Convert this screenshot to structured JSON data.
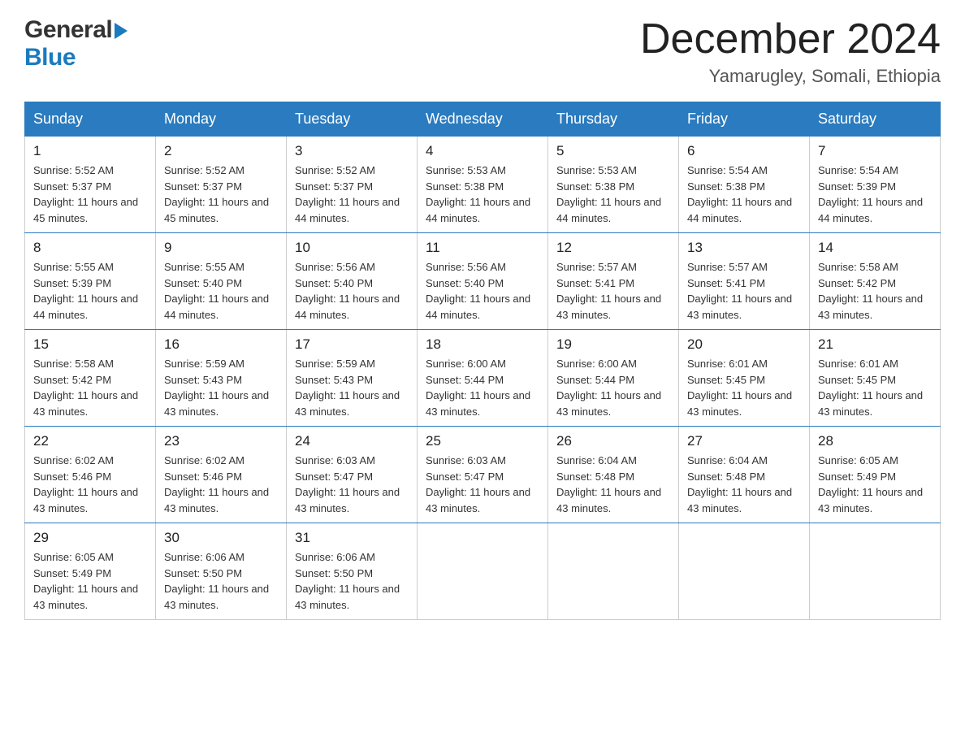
{
  "header": {
    "logo_general": "General",
    "logo_blue": "Blue",
    "title": "December 2024",
    "subtitle": "Yamarugley, Somali, Ethiopia"
  },
  "columns": [
    "Sunday",
    "Monday",
    "Tuesday",
    "Wednesday",
    "Thursday",
    "Friday",
    "Saturday"
  ],
  "weeks": [
    [
      {
        "day": "1",
        "sunrise": "Sunrise: 5:52 AM",
        "sunset": "Sunset: 5:37 PM",
        "daylight": "Daylight: 11 hours and 45 minutes."
      },
      {
        "day": "2",
        "sunrise": "Sunrise: 5:52 AM",
        "sunset": "Sunset: 5:37 PM",
        "daylight": "Daylight: 11 hours and 45 minutes."
      },
      {
        "day": "3",
        "sunrise": "Sunrise: 5:52 AM",
        "sunset": "Sunset: 5:37 PM",
        "daylight": "Daylight: 11 hours and 44 minutes."
      },
      {
        "day": "4",
        "sunrise": "Sunrise: 5:53 AM",
        "sunset": "Sunset: 5:38 PM",
        "daylight": "Daylight: 11 hours and 44 minutes."
      },
      {
        "day": "5",
        "sunrise": "Sunrise: 5:53 AM",
        "sunset": "Sunset: 5:38 PM",
        "daylight": "Daylight: 11 hours and 44 minutes."
      },
      {
        "day": "6",
        "sunrise": "Sunrise: 5:54 AM",
        "sunset": "Sunset: 5:38 PM",
        "daylight": "Daylight: 11 hours and 44 minutes."
      },
      {
        "day": "7",
        "sunrise": "Sunrise: 5:54 AM",
        "sunset": "Sunset: 5:39 PM",
        "daylight": "Daylight: 11 hours and 44 minutes."
      }
    ],
    [
      {
        "day": "8",
        "sunrise": "Sunrise: 5:55 AM",
        "sunset": "Sunset: 5:39 PM",
        "daylight": "Daylight: 11 hours and 44 minutes."
      },
      {
        "day": "9",
        "sunrise": "Sunrise: 5:55 AM",
        "sunset": "Sunset: 5:40 PM",
        "daylight": "Daylight: 11 hours and 44 minutes."
      },
      {
        "day": "10",
        "sunrise": "Sunrise: 5:56 AM",
        "sunset": "Sunset: 5:40 PM",
        "daylight": "Daylight: 11 hours and 44 minutes."
      },
      {
        "day": "11",
        "sunrise": "Sunrise: 5:56 AM",
        "sunset": "Sunset: 5:40 PM",
        "daylight": "Daylight: 11 hours and 44 minutes."
      },
      {
        "day": "12",
        "sunrise": "Sunrise: 5:57 AM",
        "sunset": "Sunset: 5:41 PM",
        "daylight": "Daylight: 11 hours and 43 minutes."
      },
      {
        "day": "13",
        "sunrise": "Sunrise: 5:57 AM",
        "sunset": "Sunset: 5:41 PM",
        "daylight": "Daylight: 11 hours and 43 minutes."
      },
      {
        "day": "14",
        "sunrise": "Sunrise: 5:58 AM",
        "sunset": "Sunset: 5:42 PM",
        "daylight": "Daylight: 11 hours and 43 minutes."
      }
    ],
    [
      {
        "day": "15",
        "sunrise": "Sunrise: 5:58 AM",
        "sunset": "Sunset: 5:42 PM",
        "daylight": "Daylight: 11 hours and 43 minutes."
      },
      {
        "day": "16",
        "sunrise": "Sunrise: 5:59 AM",
        "sunset": "Sunset: 5:43 PM",
        "daylight": "Daylight: 11 hours and 43 minutes."
      },
      {
        "day": "17",
        "sunrise": "Sunrise: 5:59 AM",
        "sunset": "Sunset: 5:43 PM",
        "daylight": "Daylight: 11 hours and 43 minutes."
      },
      {
        "day": "18",
        "sunrise": "Sunrise: 6:00 AM",
        "sunset": "Sunset: 5:44 PM",
        "daylight": "Daylight: 11 hours and 43 minutes."
      },
      {
        "day": "19",
        "sunrise": "Sunrise: 6:00 AM",
        "sunset": "Sunset: 5:44 PM",
        "daylight": "Daylight: 11 hours and 43 minutes."
      },
      {
        "day": "20",
        "sunrise": "Sunrise: 6:01 AM",
        "sunset": "Sunset: 5:45 PM",
        "daylight": "Daylight: 11 hours and 43 minutes."
      },
      {
        "day": "21",
        "sunrise": "Sunrise: 6:01 AM",
        "sunset": "Sunset: 5:45 PM",
        "daylight": "Daylight: 11 hours and 43 minutes."
      }
    ],
    [
      {
        "day": "22",
        "sunrise": "Sunrise: 6:02 AM",
        "sunset": "Sunset: 5:46 PM",
        "daylight": "Daylight: 11 hours and 43 minutes."
      },
      {
        "day": "23",
        "sunrise": "Sunrise: 6:02 AM",
        "sunset": "Sunset: 5:46 PM",
        "daylight": "Daylight: 11 hours and 43 minutes."
      },
      {
        "day": "24",
        "sunrise": "Sunrise: 6:03 AM",
        "sunset": "Sunset: 5:47 PM",
        "daylight": "Daylight: 11 hours and 43 minutes."
      },
      {
        "day": "25",
        "sunrise": "Sunrise: 6:03 AM",
        "sunset": "Sunset: 5:47 PM",
        "daylight": "Daylight: 11 hours and 43 minutes."
      },
      {
        "day": "26",
        "sunrise": "Sunrise: 6:04 AM",
        "sunset": "Sunset: 5:48 PM",
        "daylight": "Daylight: 11 hours and 43 minutes."
      },
      {
        "day": "27",
        "sunrise": "Sunrise: 6:04 AM",
        "sunset": "Sunset: 5:48 PM",
        "daylight": "Daylight: 11 hours and 43 minutes."
      },
      {
        "day": "28",
        "sunrise": "Sunrise: 6:05 AM",
        "sunset": "Sunset: 5:49 PM",
        "daylight": "Daylight: 11 hours and 43 minutes."
      }
    ],
    [
      {
        "day": "29",
        "sunrise": "Sunrise: 6:05 AM",
        "sunset": "Sunset: 5:49 PM",
        "daylight": "Daylight: 11 hours and 43 minutes."
      },
      {
        "day": "30",
        "sunrise": "Sunrise: 6:06 AM",
        "sunset": "Sunset: 5:50 PM",
        "daylight": "Daylight: 11 hours and 43 minutes."
      },
      {
        "day": "31",
        "sunrise": "Sunrise: 6:06 AM",
        "sunset": "Sunset: 5:50 PM",
        "daylight": "Daylight: 11 hours and 43 minutes."
      },
      null,
      null,
      null,
      null
    ]
  ],
  "colors": {
    "header_bg": "#2a7bbf",
    "header_text": "#ffffff",
    "border": "#2a7bbf",
    "cell_border": "#cccccc"
  }
}
